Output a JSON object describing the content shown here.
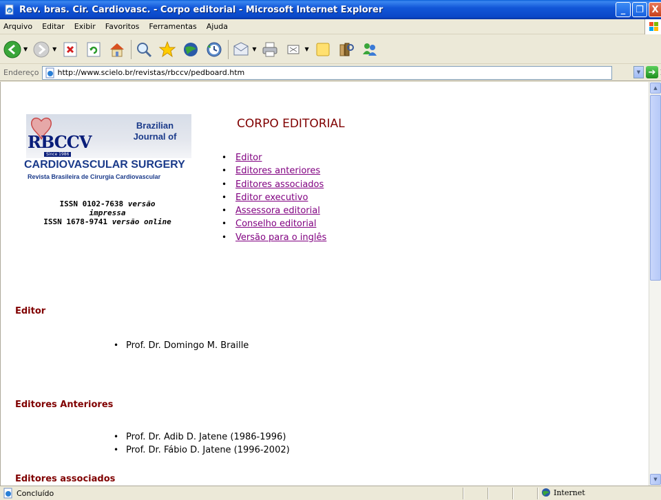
{
  "window": {
    "title": "Rev. bras. Cir. Cardiovasc. - Corpo editorial - Microsoft Internet Explorer",
    "minimize_glyph": "_",
    "maximize_glyph": "❐",
    "close_glyph": "X"
  },
  "menubar": {
    "items": [
      "Arquivo",
      "Editar",
      "Exibir",
      "Favoritos",
      "Ferramentas",
      "Ajuda"
    ]
  },
  "toolbar": {
    "icons": [
      "back-icon",
      "forward-icon",
      "stop-icon",
      "refresh-icon",
      "home-icon",
      "search-icon",
      "favorites-icon",
      "media-icon",
      "history-icon",
      "mail-icon",
      "print-icon",
      "edit-icon",
      "discuss-icon",
      "research-icon",
      "messenger-icon"
    ]
  },
  "address": {
    "label": "Endereço",
    "url": "http://www.scielo.br/revistas/rbccv/pedboard.htm",
    "go_label": "Ir"
  },
  "logo": {
    "mark": "RBCCV",
    "since": "Since 1986",
    "line1": "Brazilian",
    "line2": "Journal of",
    "line3": "CARDIOVASCULAR SURGERY",
    "line4": "Revista Brasileira de Cirurgia Cardiovascular"
  },
  "issn": {
    "print_number": "ISSN 0102-7638",
    "print_label": "versão",
    "print_label2": "impressa",
    "online_number": "ISSN 1678-9741",
    "online_label": "versão online"
  },
  "page": {
    "title": "CORPO EDITORIAL",
    "toc": [
      "Editor",
      "Editores anteriores",
      "Editores associados",
      "Editor executivo",
      "Assessora editorial",
      "Conselho editorial",
      "Versão para o inglês"
    ]
  },
  "sections": {
    "editor": {
      "heading": "Editor",
      "people": [
        "Prof. Dr. Domingo M. Braille"
      ]
    },
    "anteriores": {
      "heading": "Editores Anteriores",
      "people": [
        "Prof. Dr. Adib D. Jatene (1986-1996)",
        "Prof. Dr. Fábio D. Jatene (1996-2002)"
      ]
    },
    "associados": {
      "heading": "Editores associados"
    }
  },
  "status": {
    "text": "Concluído",
    "zone": "Internet"
  }
}
